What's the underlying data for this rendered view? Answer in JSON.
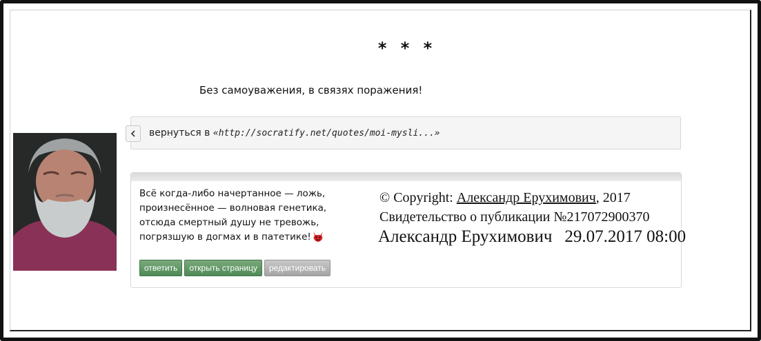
{
  "header": {
    "stars": "* * *",
    "headline": "Без самоуважения, в связях поражения!"
  },
  "back_bar": {
    "prefix": "вернуться в ",
    "link": "«http://socratify.net/quotes/moi-mysli...»"
  },
  "poem": {
    "lines": [
      "Всё когда-либо начертанное — ложь,",
      "произнесённое — волновая генетика,",
      "отсюда смертный душу не тревожь,",
      "погрязшую в догмах и в патетике!"
    ],
    "emoji_icon": "devil-face-icon"
  },
  "copyright": {
    "prefix": "© Copyright: ",
    "author": "Александр Ерухимович",
    "year_suffix": ", 2017",
    "certificate": "Свидетельство о публикации №217072900370",
    "signature_author": "Александр Ерухимович",
    "signature_date": "29.07.2017 08:00"
  },
  "actions": {
    "reply": "ответить",
    "open_page": "открыть страницу",
    "edit": "редактировать"
  },
  "colors": {
    "button_green": "#5a9463",
    "button_gray": "#b0b0b0",
    "devil_red": "#d9262b"
  }
}
